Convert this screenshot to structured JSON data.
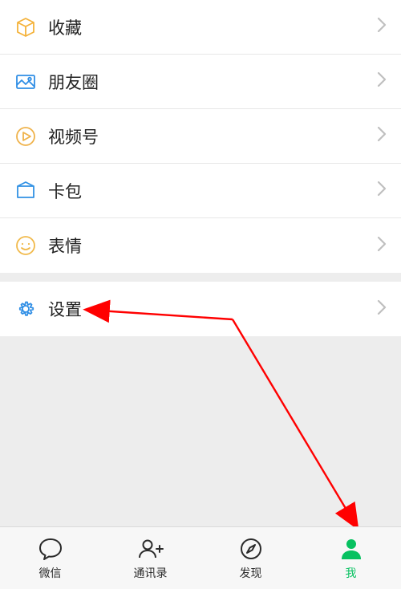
{
  "menu": {
    "group1": [
      {
        "id": "favorites",
        "label": "收藏",
        "icon": "cube-icon",
        "color": "#f4b23a"
      },
      {
        "id": "moments",
        "label": "朋友圈",
        "icon": "photo-icon",
        "color": "#2f8ee5"
      },
      {
        "id": "channels",
        "label": "视频号",
        "icon": "play-circle-icon",
        "color": "#efb24a"
      },
      {
        "id": "cards",
        "label": "卡包",
        "icon": "card-icon",
        "color": "#3191e4"
      },
      {
        "id": "stickers",
        "label": "表情",
        "icon": "smile-icon",
        "color": "#f1b94a"
      }
    ],
    "group2": [
      {
        "id": "settings",
        "label": "设置",
        "icon": "gear-icon",
        "color": "#2f8ee5"
      }
    ]
  },
  "tabs": [
    {
      "id": "chats",
      "label": "微信",
      "icon": "chat-bubble-icon",
      "active": false
    },
    {
      "id": "contacts",
      "label": "通讯录",
      "icon": "contacts-icon",
      "active": false
    },
    {
      "id": "discover",
      "label": "发现",
      "icon": "compass-icon",
      "active": false
    },
    {
      "id": "me",
      "label": "我",
      "icon": "person-icon",
      "active": true
    }
  ],
  "colors": {
    "accent": "#07c160",
    "chevron": "#bfbfbf",
    "annotation": "#ff0000"
  }
}
